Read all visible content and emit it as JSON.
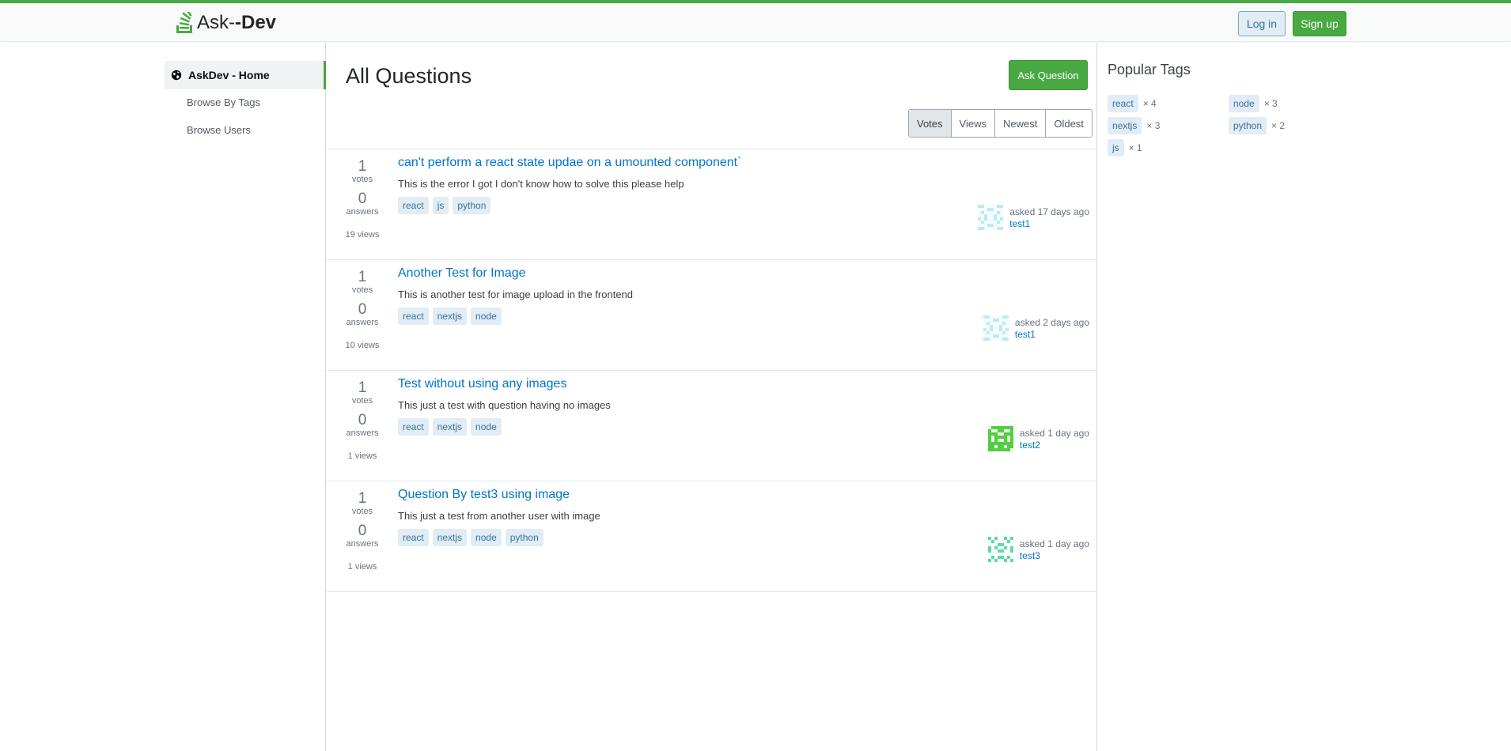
{
  "header": {
    "logo_prefix": "Ask-",
    "logo_bold": "-Dev",
    "login_label": "Log in",
    "signup_label": "Sign up",
    "accent_color": "#48a842"
  },
  "nav": {
    "home_label": "AskDev - Home",
    "items": [
      {
        "label": "Browse By Tags"
      },
      {
        "label": "Browse Users"
      }
    ]
  },
  "main": {
    "title": "All Questions",
    "ask_label": "Ask Question",
    "filters": [
      "Votes",
      "Views",
      "Newest",
      "Oldest"
    ],
    "active_filter": "Votes"
  },
  "questions": [
    {
      "votes": "1",
      "votes_label": "votes",
      "answers": "0",
      "answers_label": "answers",
      "views": "19 views",
      "title": "can't perform a react state updae on a umounted component`",
      "excerpt": "This is the error I got I don't know how to solve this please help",
      "tags": [
        "react",
        "js",
        "python"
      ],
      "asked": "asked 17 days ago",
      "user": "test1",
      "avatar_color": "#bfe9ee"
    },
    {
      "votes": "1",
      "votes_label": "votes",
      "answers": "0",
      "answers_label": "answers",
      "views": "10 views",
      "title": "Another Test for Image",
      "excerpt": "This is another test for image upload in  the frontend",
      "tags": [
        "react",
        "nextjs",
        "node"
      ],
      "asked": "asked 2 days ago",
      "user": "test1",
      "avatar_color": "#bfe9ee"
    },
    {
      "votes": "1",
      "votes_label": "votes",
      "answers": "0",
      "answers_label": "answers",
      "views": "1 views",
      "title": "Test without using any images",
      "excerpt": "This just a test with question having no images",
      "tags": [
        "react",
        "nextjs",
        "node"
      ],
      "asked": "asked 1 day ago",
      "user": "test2",
      "avatar_color": "#55cc44"
    },
    {
      "votes": "1",
      "votes_label": "votes",
      "answers": "0",
      "answers_label": "answers",
      "views": "1 views",
      "title": "Question By test3 using image",
      "excerpt": "This just a test from another user with image",
      "tags": [
        "react",
        "nextjs",
        "node",
        "python"
      ],
      "asked": "asked 1 day ago",
      "user": "test3",
      "avatar_color": "#5fd9a8"
    }
  ],
  "sidebar": {
    "title": "Popular Tags",
    "tags": [
      {
        "name": "react",
        "count": "× 4"
      },
      {
        "name": "node",
        "count": "× 3"
      },
      {
        "name": "nextjs",
        "count": "× 3"
      },
      {
        "name": "python",
        "count": "× 2"
      },
      {
        "name": "js",
        "count": "× 1"
      }
    ]
  }
}
